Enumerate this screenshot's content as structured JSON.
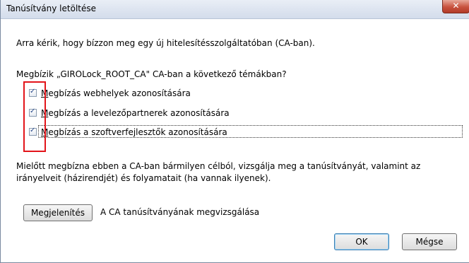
{
  "window": {
    "title": "Tanúsítvány letöltése",
    "close_label": "✕"
  },
  "intro_text": "Arra kérik, hogy bízzon meg egy új hitelesítésszolgáltatóban (CA-ban).",
  "question_text": "Megbízik „GIROLock_ROOT_CA\" CA-ban a következő témákban?",
  "checkboxes": [
    {
      "mnemonic": "M",
      "rest": "egbízás webhelyek azonosítására",
      "checked": true
    },
    {
      "mnemonic": "M",
      "rest": "egbízás a levelezőpartnerek azonosítására",
      "checked": true
    },
    {
      "mnemonic": "M",
      "rest": "egbízás a szoftverfejlesztők azonosítására",
      "checked": true
    }
  ],
  "checkmark": "✓",
  "warning_line1": "Mielőtt megbízna ebben a CA-ban bármilyen célból, vizsgálja meg a tanúsítványát, valamint az",
  "warning_line2": "irányelveit (házirendjét) és folyamatait (ha vannak ilyenek).",
  "view_button": {
    "label": "Megjelenítés"
  },
  "view_description": "A CA tanúsítványának megvizsgálása",
  "ok_button": {
    "label": "OK"
  },
  "cancel_button": {
    "label": "Mégse"
  },
  "colors": {
    "highlight_box": "#e2141a",
    "close_button": "#c8523e"
  }
}
